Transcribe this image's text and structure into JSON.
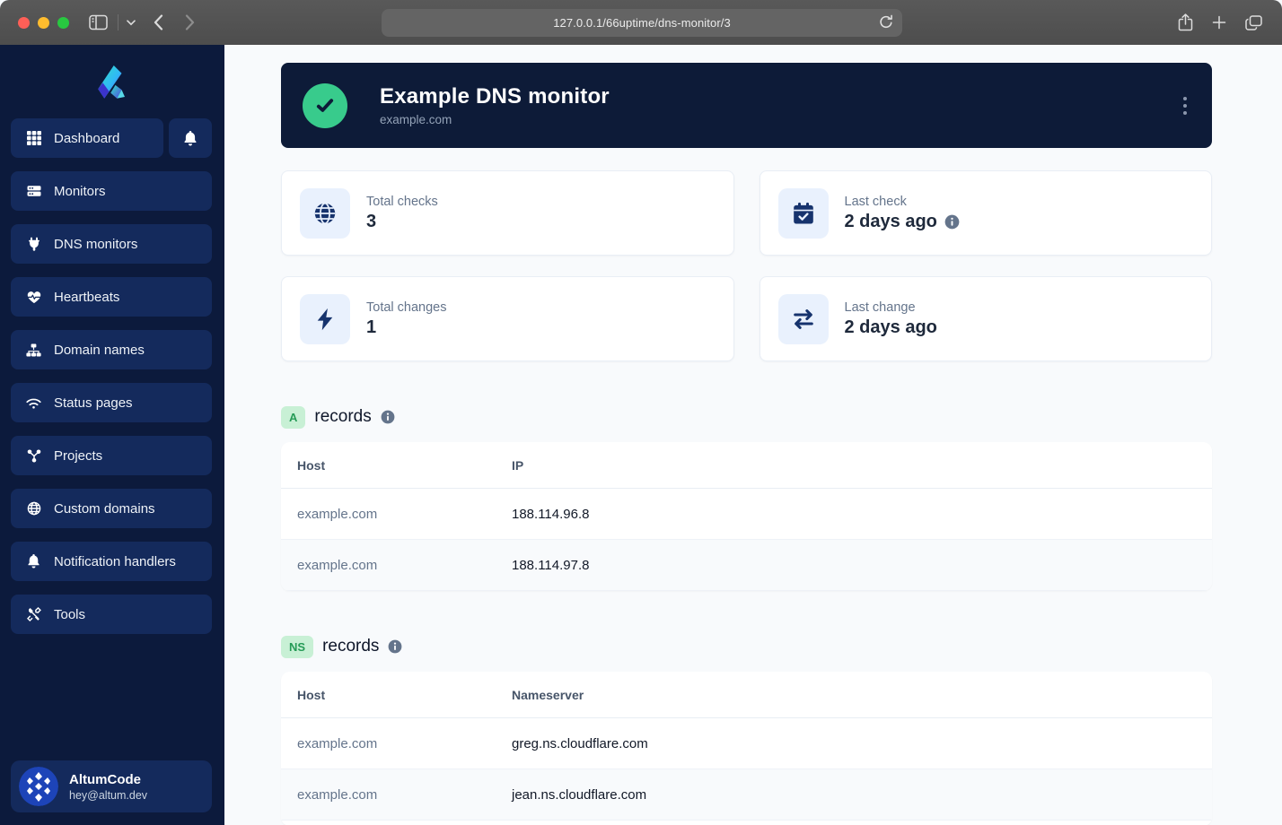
{
  "browser": {
    "url": "127.0.0.1/66uptime/dns-monitor/3"
  },
  "sidebar": {
    "items": [
      {
        "label": "Dashboard"
      },
      {
        "label": "Monitors"
      },
      {
        "label": "DNS monitors"
      },
      {
        "label": "Heartbeats"
      },
      {
        "label": "Domain names"
      },
      {
        "label": "Status pages"
      },
      {
        "label": "Projects"
      },
      {
        "label": "Custom domains"
      },
      {
        "label": "Notification handlers"
      },
      {
        "label": "Tools"
      }
    ],
    "user": {
      "name": "AltumCode",
      "email": "hey@altum.dev"
    }
  },
  "header": {
    "title": "Example DNS monitor",
    "subtitle": "example.com",
    "status": "up"
  },
  "stats": [
    {
      "icon": "globe-icon",
      "label": "Total checks",
      "value": "3"
    },
    {
      "icon": "calendar-check-icon",
      "label": "Last check",
      "value": "2 days ago",
      "has_info": true
    },
    {
      "icon": "bolt-icon",
      "label": "Total changes",
      "value": "1"
    },
    {
      "icon": "arrows-right-left-icon",
      "label": "Last change",
      "value": "2 days ago"
    }
  ],
  "sections": [
    {
      "badge": "A",
      "title": "records",
      "columns": [
        "Host",
        "IP"
      ],
      "rows": [
        [
          "example.com",
          "188.114.96.8"
        ],
        [
          "example.com",
          "188.114.97.8"
        ]
      ]
    },
    {
      "badge": "NS",
      "title": "records",
      "columns": [
        "Host",
        "Nameserver"
      ],
      "rows": [
        [
          "example.com",
          "greg.ns.cloudflare.com"
        ],
        [
          "example.com",
          "jean.ns.cloudflare.com"
        ]
      ]
    }
  ],
  "colors": {
    "sidebar_bg": "#0c1a3c",
    "sidebar_item_bg": "#142a5c",
    "header_card_bg": "#0d1b38",
    "status_up_green": "#38cb8c",
    "badge_green_bg": "#c8f0d5",
    "badge_green_text": "#259b56",
    "stat_icon_bg": "#e9f1fd",
    "stat_icon_fg": "#16336d",
    "main_bg": "#f8fafc"
  }
}
